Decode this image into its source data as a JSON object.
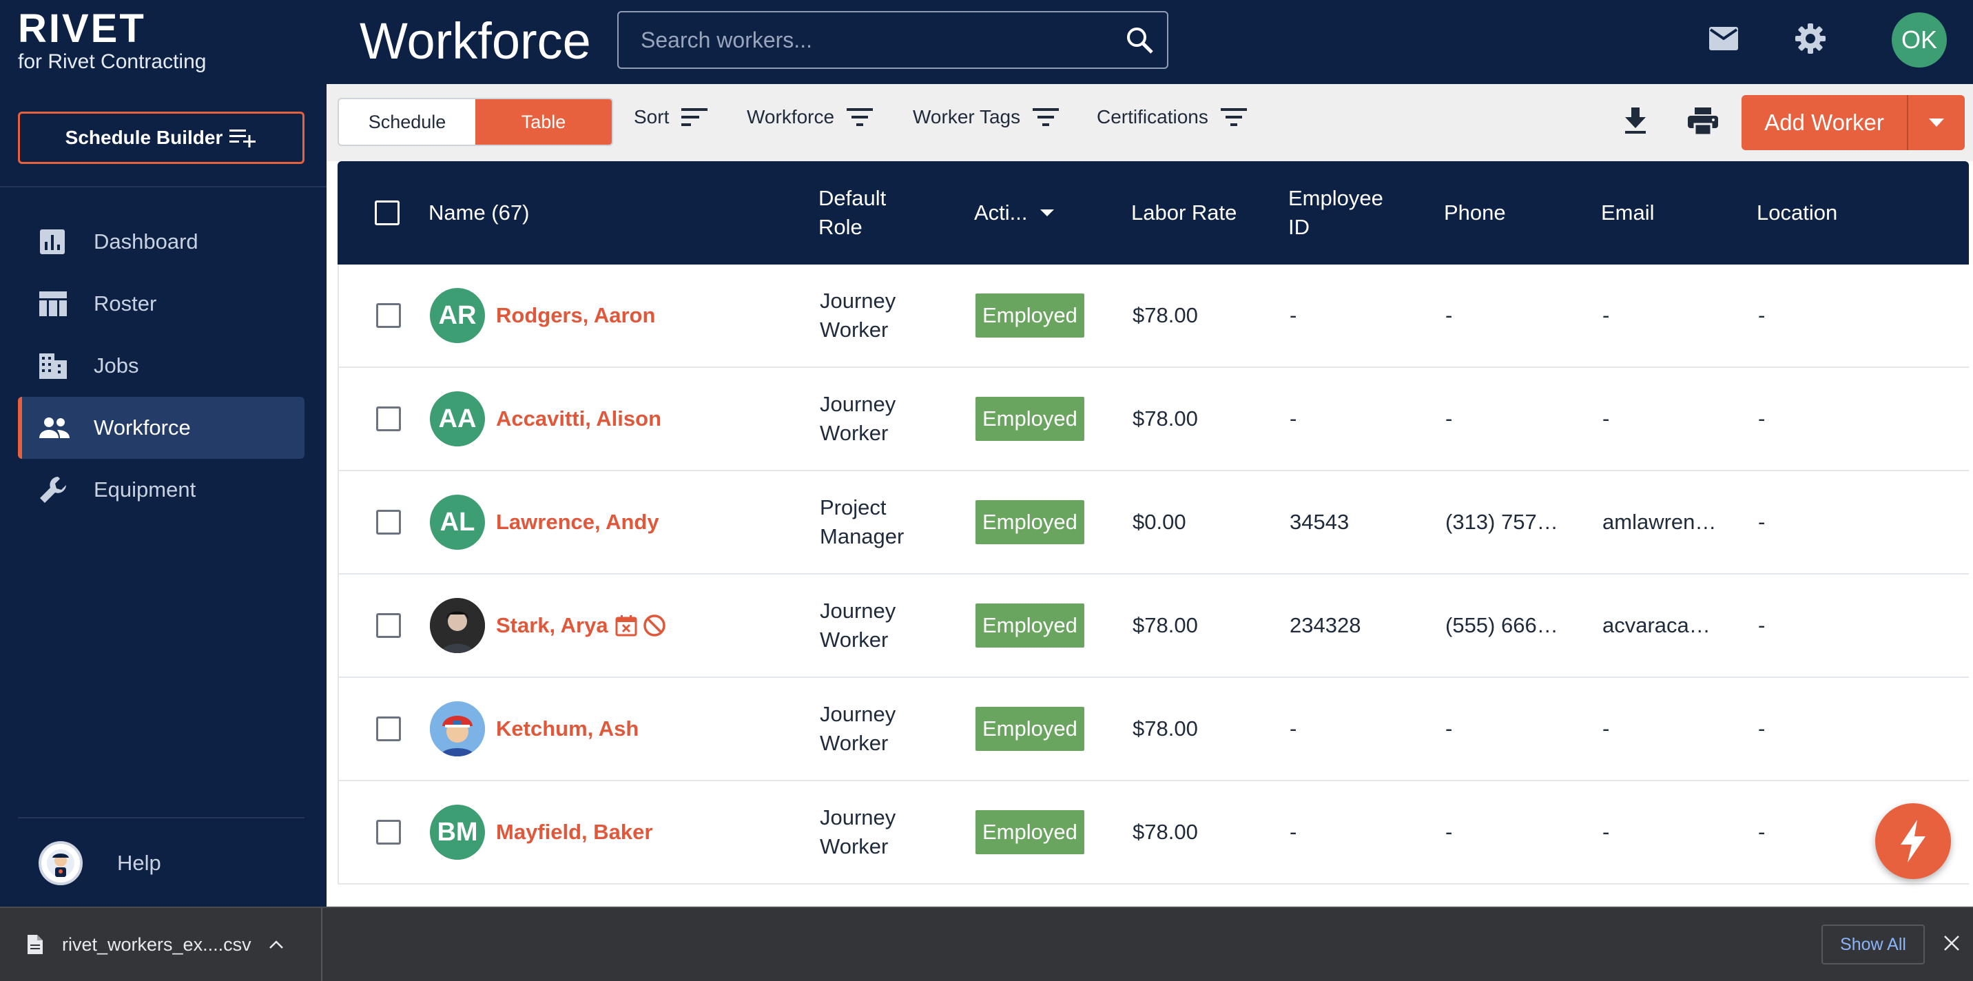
{
  "app": {
    "brand": "RIVET",
    "company": "for Rivet Contracting"
  },
  "sidebar": {
    "schedule_builder": "Schedule Builder",
    "items": [
      {
        "label": "Dashboard",
        "icon": "chart-icon"
      },
      {
        "label": "Roster",
        "icon": "table-icon"
      },
      {
        "label": "Jobs",
        "icon": "building-icon"
      },
      {
        "label": "Workforce",
        "icon": "people-icon",
        "active": true
      },
      {
        "label": "Equipment",
        "icon": "wrench-icon"
      }
    ],
    "help": "Help"
  },
  "header": {
    "title": "Workforce",
    "search_placeholder": "Search workers...",
    "user_initials": "OK"
  },
  "toolbar": {
    "view_schedule": "Schedule",
    "view_table": "Table",
    "active_view": "Table",
    "filters": [
      "Sort",
      "Workforce",
      "Worker Tags",
      "Certifications"
    ],
    "add_worker": "Add Worker"
  },
  "table": {
    "columns": {
      "name": "Name (67)",
      "role": "Default Role",
      "status": "Acti...",
      "rate": "Labor Rate",
      "employee_id": "Employee ID",
      "phone": "Phone",
      "email": "Email",
      "location": "Location"
    },
    "rows": [
      {
        "initials": "AR",
        "name": "Rodgers, Aaron",
        "role": "Journey Worker",
        "status": "Employed",
        "rate": "$78.00",
        "employee_id": "-",
        "phone": "-",
        "email": "-",
        "location": "-"
      },
      {
        "initials": "AA",
        "name": "Accavitti, Alison",
        "role": "Journey Worker",
        "status": "Employed",
        "rate": "$78.00",
        "employee_id": "-",
        "phone": "-",
        "email": "-",
        "location": "-"
      },
      {
        "initials": "AL",
        "name": "Lawrence, Andy",
        "role": "Project Manager",
        "status": "Employed",
        "rate": "$0.00",
        "employee_id": "34543",
        "phone": "(313) 757…",
        "email": "amlawren…",
        "location": "-"
      },
      {
        "initials": "",
        "name": "Stark, Arya",
        "role": "Journey Worker",
        "status": "Employed",
        "rate": "$78.00",
        "employee_id": "234328",
        "phone": "(555) 666…",
        "email": "acvaraca…",
        "location": "-"
      },
      {
        "initials": "",
        "name": "Ketchum, Ash",
        "role": "Journey Worker",
        "status": "Employed",
        "rate": "$78.00",
        "employee_id": "-",
        "phone": "-",
        "email": "-",
        "location": "-"
      },
      {
        "initials": "BM",
        "name": "Mayfield, Baker",
        "role": "Journey Worker",
        "status": "Employed",
        "rate": "$78.00",
        "employee_id": "-",
        "phone": "-",
        "email": "-",
        "location": "-"
      }
    ]
  },
  "downloads": {
    "file": "rivet_workers_ex....csv",
    "show_all": "Show All"
  },
  "colors": {
    "navy": "#0d2145",
    "accent": "#e8613f",
    "employed": "#6aa55f",
    "avatar": "#3e9e73"
  }
}
